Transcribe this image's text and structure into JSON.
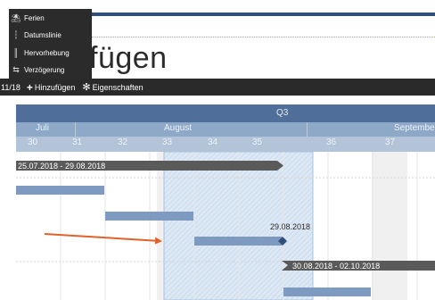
{
  "menu": {
    "items": [
      {
        "icon": "ferien-icon",
        "glyph": "⛱",
        "label": "Ferien"
      },
      {
        "icon": "datumslinie-icon",
        "glyph": "┆",
        "label": "Datumslinie"
      },
      {
        "icon": "hervorhebung-icon",
        "glyph": "║",
        "label": "Hervorhebung"
      },
      {
        "icon": "verzoegerung-icon",
        "glyph": "⇆",
        "label": "Verzögerung"
      }
    ]
  },
  "title": "fügen",
  "toolbar": {
    "count": "11/18",
    "add_label": "Hinzufügen",
    "props_label": "Eigenschaften"
  },
  "timeline": {
    "quarter": "Q3",
    "months": [
      "Juli",
      "August",
      "September"
    ],
    "weeks": [
      "30",
      "31",
      "32",
      "33",
      "34",
      "35",
      "36",
      "37"
    ]
  },
  "bars": {
    "summary1_label": "25.07.2018 - 29.08.2018",
    "milestone_label": "29.08.2018",
    "summary2_label": "30.08.2018 - 02.10.2018"
  },
  "colors": {
    "header_dark": "#4f6f9a",
    "header_mid": "#8ea8c8",
    "header_light": "#b3c3d8",
    "task_bar": "#7f9ac0",
    "summary_bar": "#5a5a5a",
    "highlight": "#dce8f4",
    "arrow": "#e0622a",
    "milestone": "#2f4f7a"
  }
}
